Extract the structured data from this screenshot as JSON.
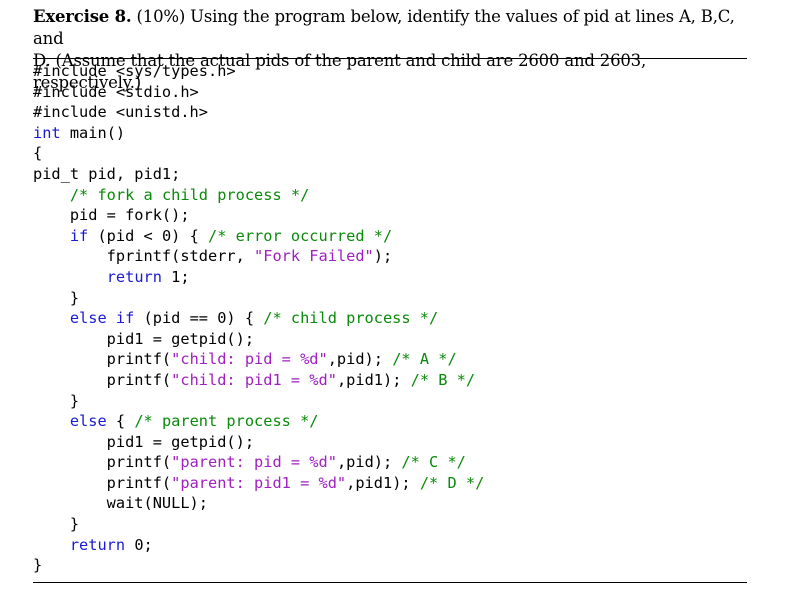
{
  "exercise": {
    "title": "Exercise 8.",
    "weight": "(10%)",
    "prompt_line1": "Using the program below, identify the values of pid at lines A, B,C, and",
    "prompt_line2": "D. (Assume that the actual pids of the parent and child are 2600 and 2603, respectively.)"
  },
  "colors": {
    "keyword": "#1a1ad6",
    "comment": "#0a8a0a",
    "string": "#a020c0",
    "text": "#000000"
  },
  "code": {
    "lines": [
      [
        {
          "t": "#include <sys/types.h>",
          "c": ""
        }
      ],
      [
        {
          "t": "#include <stdio.h>",
          "c": ""
        }
      ],
      [
        {
          "t": "#include <unistd.h>",
          "c": ""
        }
      ],
      [
        {
          "t": "int",
          "c": "kw"
        },
        {
          "t": " main()",
          "c": ""
        }
      ],
      [
        {
          "t": "{",
          "c": ""
        }
      ],
      [
        {
          "t": "pid_t pid, pid1;",
          "c": ""
        }
      ],
      [
        {
          "t": "    ",
          "c": ""
        },
        {
          "t": "/* fork a child process */",
          "c": "cm"
        }
      ],
      [
        {
          "t": "    pid = fork();",
          "c": ""
        }
      ],
      [
        {
          "t": "    ",
          "c": ""
        },
        {
          "t": "if",
          "c": "kw"
        },
        {
          "t": " (pid < 0) { ",
          "c": ""
        },
        {
          "t": "/* error occurred */",
          "c": "cm"
        }
      ],
      [
        {
          "t": "        fprintf(stderr, ",
          "c": ""
        },
        {
          "t": "\"Fork Failed\"",
          "c": "str"
        },
        {
          "t": ");",
          "c": ""
        }
      ],
      [
        {
          "t": "        ",
          "c": ""
        },
        {
          "t": "return",
          "c": "kw"
        },
        {
          "t": " 1;",
          "c": ""
        }
      ],
      [
        {
          "t": "    }",
          "c": ""
        }
      ],
      [
        {
          "t": "    ",
          "c": ""
        },
        {
          "t": "else if",
          "c": "kw"
        },
        {
          "t": " (pid == 0) { ",
          "c": ""
        },
        {
          "t": "/* child process */",
          "c": "cm"
        }
      ],
      [
        {
          "t": "        pid1 = getpid();",
          "c": ""
        }
      ],
      [
        {
          "t": "        printf(",
          "c": ""
        },
        {
          "t": "\"child: pid = %d\"",
          "c": "str"
        },
        {
          "t": ",pid); ",
          "c": ""
        },
        {
          "t": "/* A */",
          "c": "cm"
        }
      ],
      [
        {
          "t": "        printf(",
          "c": ""
        },
        {
          "t": "\"child: pid1 = %d\"",
          "c": "str"
        },
        {
          "t": ",pid1); ",
          "c": ""
        },
        {
          "t": "/* B */",
          "c": "cm"
        }
      ],
      [
        {
          "t": "    }",
          "c": ""
        }
      ],
      [
        {
          "t": "    ",
          "c": ""
        },
        {
          "t": "else",
          "c": "kw"
        },
        {
          "t": " { ",
          "c": ""
        },
        {
          "t": "/* parent process */",
          "c": "cm"
        }
      ],
      [
        {
          "t": "        pid1 = getpid();",
          "c": ""
        }
      ],
      [
        {
          "t": "        printf(",
          "c": ""
        },
        {
          "t": "\"parent: pid = %d\"",
          "c": "str"
        },
        {
          "t": ",pid); ",
          "c": ""
        },
        {
          "t": "/* C */",
          "c": "cm"
        }
      ],
      [
        {
          "t": "        printf(",
          "c": ""
        },
        {
          "t": "\"parent: pid1 = %d\"",
          "c": "str"
        },
        {
          "t": ",pid1); ",
          "c": ""
        },
        {
          "t": "/* D */",
          "c": "cm"
        }
      ],
      [
        {
          "t": "        wait(NULL);",
          "c": ""
        }
      ],
      [
        {
          "t": "    }",
          "c": ""
        }
      ],
      [
        {
          "t": "    ",
          "c": ""
        },
        {
          "t": "return",
          "c": "kw"
        },
        {
          "t": " 0;",
          "c": ""
        }
      ],
      [
        {
          "t": "}",
          "c": ""
        }
      ]
    ]
  }
}
